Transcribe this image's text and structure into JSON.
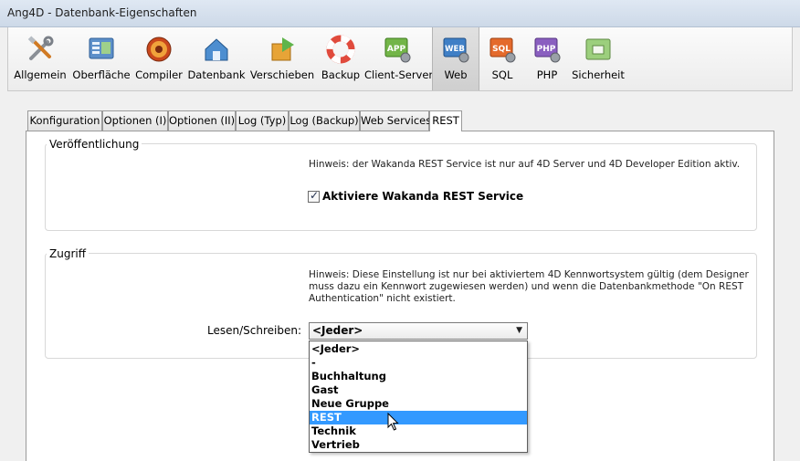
{
  "window": {
    "title": "Ang4D - Datenbank-Eigenschaften"
  },
  "toolbar": {
    "items": [
      {
        "label": "Allgemein",
        "icon": "tools-icon"
      },
      {
        "label": "Oberfläche",
        "icon": "interface-icon"
      },
      {
        "label": "Compiler",
        "icon": "compiler-icon"
      },
      {
        "label": "Datenbank",
        "icon": "database-icon"
      },
      {
        "label": "Verschieben",
        "icon": "move-icon"
      },
      {
        "label": "Backup",
        "icon": "lifebuoy-icon"
      },
      {
        "label": "Client-Server",
        "icon": "app-icon",
        "badge": "APP"
      },
      {
        "label": "Web",
        "icon": "web-icon",
        "badge": "WEB"
      },
      {
        "label": "SQL",
        "icon": "sql-icon",
        "badge": "SQL"
      },
      {
        "label": "PHP",
        "icon": "php-icon",
        "badge": "PHP"
      },
      {
        "label": "Sicherheit",
        "icon": "security-icon"
      }
    ],
    "selected": "Web"
  },
  "tabs": [
    "Konfiguration",
    "Optionen (I)",
    "Optionen (II)",
    "Log (Typ)",
    "Log (Backup)",
    "Web Services",
    "REST"
  ],
  "active_tab": "REST",
  "publish": {
    "title": "Veröffentlichung",
    "hint": "Hinweis: der Wakanda REST Service ist nur auf 4D Server und 4D Developer Edition aktiv.",
    "checkbox_label": "Aktiviere Wakanda REST Service",
    "checked": true
  },
  "access": {
    "title": "Zugriff",
    "hint_lines": [
      "Hinweis: Diese Einstellung ist nur bei aktiviertem 4D Kennwortsystem gültig (dem Designer",
      "muss dazu ein Kennwort zugewiesen werden) und wenn die Datenbankmethode \"On REST",
      "Authentication\" nicht existiert."
    ],
    "rw_label": "Lesen/Schreiben:",
    "rw_value": "<Jeder>",
    "options": [
      "<Jeder>",
      "-",
      "Buchhaltung",
      "Gast",
      "Neue Gruppe",
      "REST",
      "Technik",
      "Vertrieb"
    ],
    "highlighted": "REST"
  },
  "colors": {
    "highlight": "#3399ff",
    "titlebar": "#cdd9e8"
  }
}
